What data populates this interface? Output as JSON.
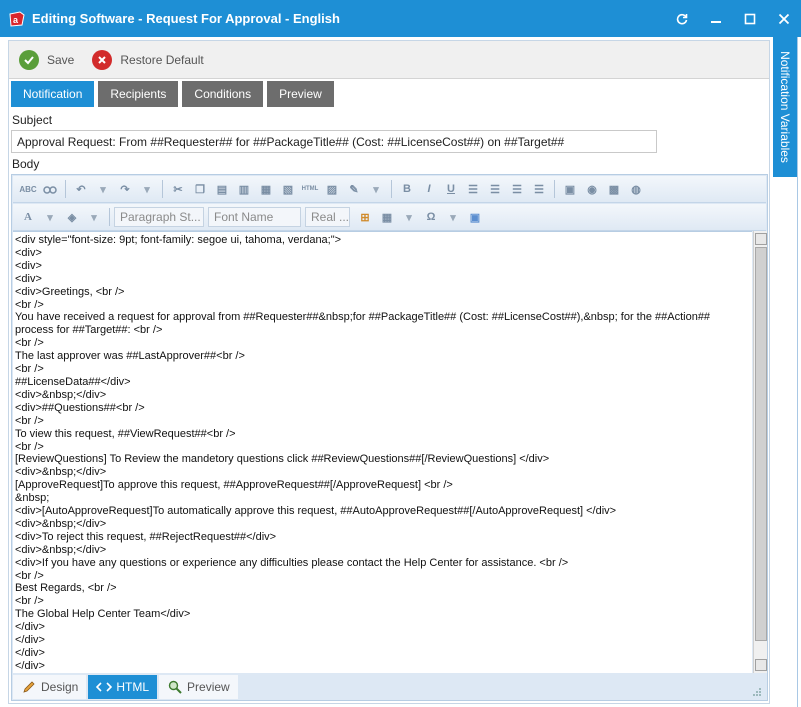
{
  "window": {
    "title": "Editing Software - Request For Approval - English",
    "side_tab": "Notification Variables"
  },
  "toolbar": {
    "save_label": "Save",
    "restore_label": "Restore Default"
  },
  "tabs": [
    {
      "label": "Notification",
      "active": true
    },
    {
      "label": "Recipients",
      "active": false
    },
    {
      "label": "Conditions",
      "active": false
    },
    {
      "label": "Preview",
      "active": false
    }
  ],
  "subject": {
    "label": "Subject",
    "value": "Approval Request: From ##Requester## for ##PackageTitle## (Cost: ##LicenseCost##) on ##Target##"
  },
  "body": {
    "label": "Body",
    "dropdowns": {
      "paragraph_style": "Paragraph St...",
      "font_name": "Font Name",
      "font_size": "Real ..."
    },
    "html_lines": [
      "<div style=\"font-size: 9pt; font-family: segoe ui, tahoma, verdana;\">",
      "<div>",
      "<div>",
      "<div>",
      "<div>Greetings, <br />",
      "<br />",
      "You have received a request for approval from ##Requester##&nbsp;for ##PackageTitle## (Cost: ##LicenseCost##),&nbsp; for the ##Action## process for ##Target##: <br />",
      "<br />",
      "The last approver was ##LastApprover##<br />",
      "<br />",
      "##LicenseData##</div>",
      "<div>&nbsp;</div>",
      "<div>##Questions##<br />",
      "<br />",
      "To view this request, ##ViewRequest##<br />",
      "<br />",
      "[ReviewQuestions] To Review the mandetory questions click ##ReviewQuestions##[/ReviewQuestions] </div>",
      "<div>&nbsp;</div>",
      "[ApproveRequest]To approve this request, ##ApproveRequest##[/ApproveRequest] <br />",
      "&nbsp;",
      "<div>[AutoApproveRequest]To automatically approve this request, ##AutoApproveRequest##[/AutoApproveRequest] </div>",
      "<div>&nbsp;</div>",
      "<div>To reject this request, ##RejectRequest##</div>",
      "<div>&nbsp;</div>",
      "<div>If you have any questions or experience any difficulties please contact the Help Center for assistance. <br />",
      "<br />",
      "Best Regards, <br />",
      "<br />",
      "The Global Help Center Team</div>",
      "</div>",
      "</div>",
      "</div>",
      "</div>"
    ]
  },
  "modes": [
    {
      "label": "Design",
      "active": false
    },
    {
      "label": "HTML",
      "active": true
    },
    {
      "label": "Preview",
      "active": false
    }
  ],
  "colors": {
    "accent": "#1e8fd5",
    "inactive_tab": "#6d6d6d"
  }
}
